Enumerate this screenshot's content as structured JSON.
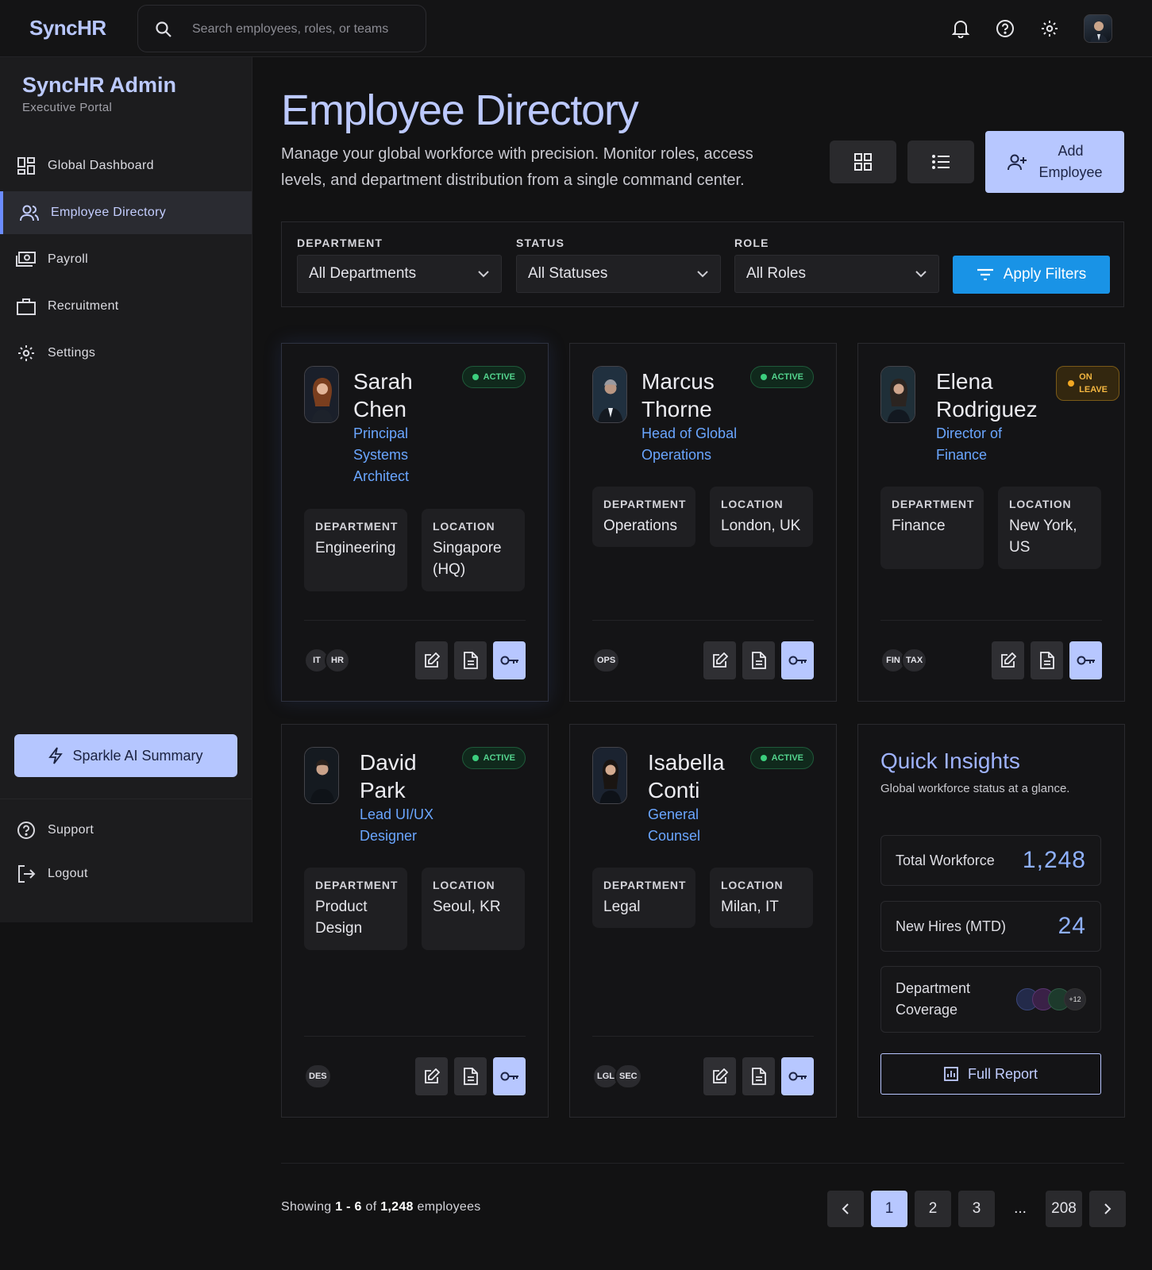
{
  "app": {
    "brand": "SyncHR"
  },
  "search": {
    "placeholder": "Search employees, roles, or teams"
  },
  "top_icons": [
    "bell-icon",
    "help-icon",
    "gear-icon",
    "user-avatar"
  ],
  "sidebar": {
    "title": "SyncHR Admin",
    "subtitle": "Executive Portal",
    "items": [
      {
        "label": "Global Dashboard",
        "icon": "dashboard-icon"
      },
      {
        "label": "Employee Directory",
        "icon": "people-icon",
        "active": true
      },
      {
        "label": "Payroll",
        "icon": "payroll-icon"
      },
      {
        "label": "Recruitment",
        "icon": "briefcase-icon"
      },
      {
        "label": "Settings",
        "icon": "gear-icon"
      }
    ],
    "sparkle_label": "Sparkle AI Summary",
    "bottom": [
      {
        "label": "Support",
        "icon": "help-icon"
      },
      {
        "label": "Logout",
        "icon": "logout-icon"
      }
    ]
  },
  "header": {
    "title": "Employee Directory",
    "description": "Manage your global workforce with precision. Monitor roles, access levels, and department distribution from a single command center.",
    "add_line1": "Add",
    "add_line2": "Employee"
  },
  "filters": {
    "department": {
      "label": "DEPARTMENT",
      "value": "All Departments"
    },
    "status": {
      "label": "STATUS",
      "value": "All Statuses"
    },
    "role": {
      "label": "ROLE",
      "value": "All Roles"
    },
    "apply_label": "Apply Filters"
  },
  "card_labels": {
    "department": "DEPARTMENT",
    "location": "LOCATION"
  },
  "employees": [
    {
      "first": "Sarah",
      "last": "Chen",
      "role1": "Principal",
      "role2": "Systems",
      "role3": "Architect",
      "status": "ACTIVE",
      "department": "Engineering",
      "loc1": "Singapore",
      "loc2": "(HQ)",
      "tags": [
        "IT",
        "HR"
      ]
    },
    {
      "first": "Marcus",
      "last": "Thorne",
      "role1": "Head of Global",
      "role2": "Operations",
      "status": "ACTIVE",
      "department": "Operations",
      "loc1": "London, UK",
      "tags": [
        "OPS"
      ]
    },
    {
      "first": "Elena",
      "last": "Rodriguez",
      "role1": "Director of",
      "role2": "Finance",
      "status1": "ON",
      "status2": "LEAVE",
      "department": "Finance",
      "loc1": "New York,",
      "loc2": "US",
      "tags": [
        "FIN",
        "TAX"
      ]
    },
    {
      "first": "David",
      "last": "Park",
      "role1": "Lead UI/UX",
      "role2": "Designer",
      "status": "ACTIVE",
      "dep1": "Product",
      "dep2": "Design",
      "loc1": "Seoul, KR",
      "tags": [
        "DES"
      ]
    },
    {
      "first": "Isabella",
      "last": "Conti",
      "role1": "General",
      "role2": "Counsel",
      "status": "ACTIVE",
      "department": "Legal",
      "loc1": "Milan, IT",
      "tags": [
        "LGL",
        "SEC"
      ]
    }
  ],
  "insights": {
    "title": "Quick Insights",
    "subtitle": "Global workforce status at a glance.",
    "total_label": "Total Workforce",
    "total_value": "1,248",
    "hires_label": "New Hires (MTD)",
    "hires_value": "24",
    "coverage_label1": "Department",
    "coverage_label2": "Coverage",
    "coverage_more": "+12",
    "report_label": "Full Report"
  },
  "pagination": {
    "showing_prefix": "Showing",
    "range": "1 - 6",
    "of": "of",
    "total": "1,248",
    "suffix": "employees",
    "pages": [
      "1",
      "2",
      "3",
      "...",
      "208"
    ],
    "current": "1"
  },
  "colors": {
    "accent": "#b7c7ff",
    "link": "#6aa6ff",
    "apply": "#1993e6",
    "active": "#53d38d",
    "leave": "#f3b640"
  }
}
